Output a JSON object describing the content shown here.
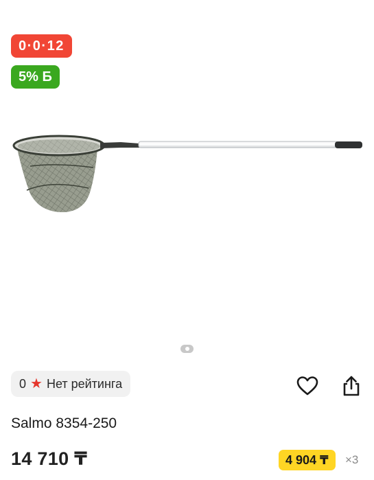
{
  "badges": {
    "installment": "0·0·12",
    "bonus": "5% Б"
  },
  "product": {
    "image_icon": "landing-net-image",
    "title": "Salmo 8354-250",
    "price": "14 710 ₸"
  },
  "carousel": {
    "current": 1,
    "total": 1
  },
  "rating": {
    "count": "0",
    "icon": "star-icon",
    "text": "Нет рейтинга"
  },
  "actions": {
    "favorite_icon": "heart-icon",
    "share_icon": "share-icon"
  },
  "installment": {
    "monthly": "4 904 ₸",
    "multiplier": "×3"
  },
  "colors": {
    "installment_badge": "#f14635",
    "bonus_badge": "#3aa81f",
    "monthly_chip": "#ffd524",
    "star": "#e5362c"
  }
}
